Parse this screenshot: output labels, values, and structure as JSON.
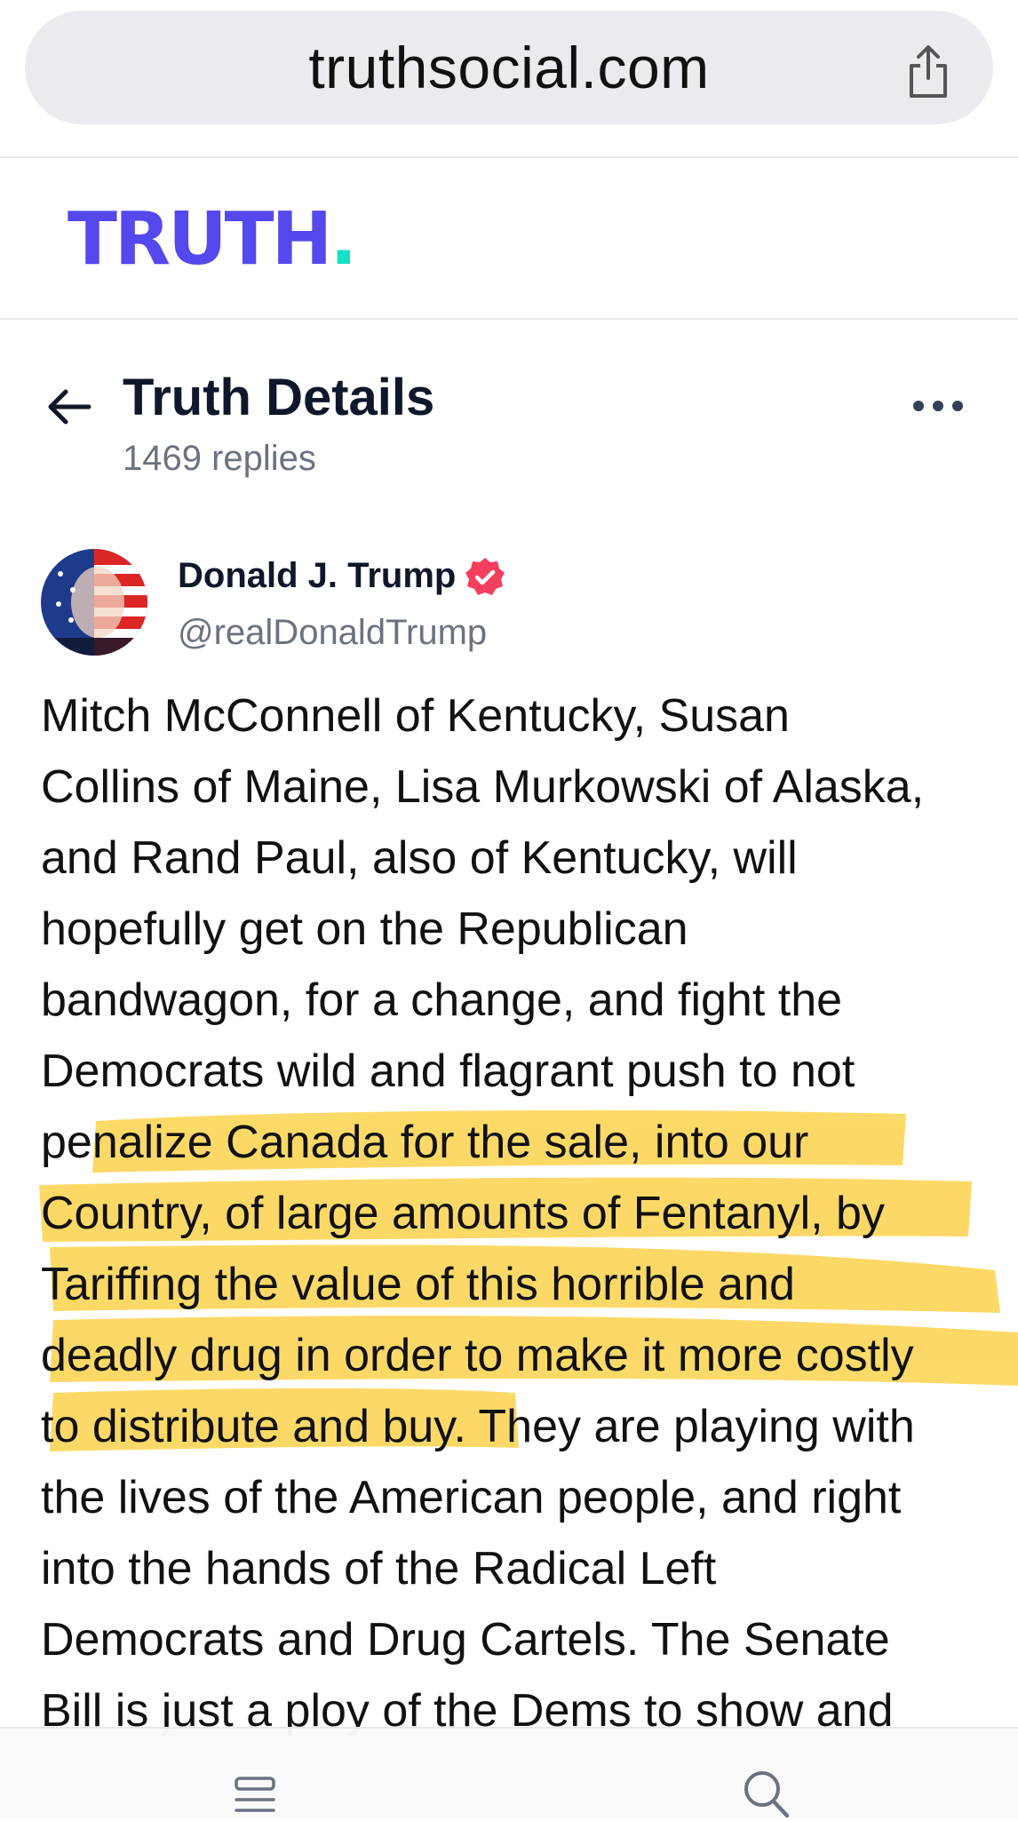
{
  "browser": {
    "url": "truthsocial.com",
    "share_icon": "share-icon"
  },
  "brand": {
    "logo_text": "TRUTH",
    "logo_dot": ".",
    "logo_color": "#5448ee",
    "logo_dot_color": "#17e2c7"
  },
  "header": {
    "title": "Truth Details",
    "replies": "1469 replies",
    "back_icon": "arrow-left-icon",
    "more_icon": "more-horizontal-icon"
  },
  "author": {
    "name": "Donald J. Trump",
    "handle": "@realDonaldTrump",
    "verified_icon": "verified-badge-icon",
    "verified_color": "#f43f5e"
  },
  "post": {
    "text": "Mitch McConnell of Kentucky, Susan\nCollins of Maine, Lisa Murkowski of Alaska,\nand Rand Paul, also of Kentucky, will\nhopefully get on the Republican\nbandwagon, for a change, and fight the\nDemocrats wild and flagrant push to not\npenalize Canada for the sale, into our\nCountry, of large amounts of Fentanyl, by\nTariffing the value of this horrible and\ndeadly drug in order to make it more costly\nto distribute and buy. They are playing with\nthe lives of the American people, and right\ninto the hands of the Radical Left\nDemocrats and Drug Cartels. The Senate\nBill is just a ploy of the Dems to show and",
    "highlight_color": "#fcd34d"
  },
  "bottom_nav": {
    "items": [
      "feed-icon",
      "search-icon"
    ]
  }
}
